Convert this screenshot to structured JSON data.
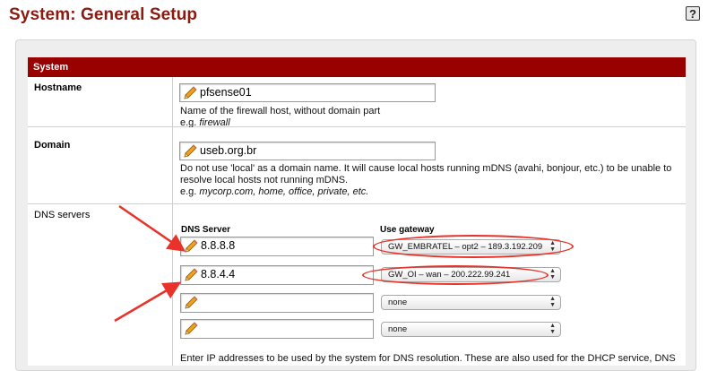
{
  "page": {
    "title": "System: General Setup",
    "help_icon": "help-icon"
  },
  "section": {
    "title": "System"
  },
  "hostname": {
    "label": "Hostname",
    "value": "pfsense01",
    "help_line1": "Name of the firewall host, without domain part",
    "help_eg": "e.g. ",
    "help_example": "firewall"
  },
  "domain": {
    "label": "Domain",
    "value": "useb.org.br",
    "help_line1": "Do not use 'local' as a domain name. It will cause local hosts running mDNS (avahi, bonjour, etc.) to be unable to",
    "help_line2": "resolve local hosts not running mDNS.",
    "help_eg": "e.g. ",
    "help_example": "mycorp.com, home, office, private, etc."
  },
  "dns": {
    "label": "DNS servers",
    "col_server": "DNS Server",
    "col_gateway": "Use gateway",
    "rows": [
      {
        "server": "8.8.8.8",
        "gateway": "GW_EMBRATEL – opt2 – 189.3.192.209"
      },
      {
        "server": "8.8.4.4",
        "gateway": "GW_OI – wan – 200.222.99.241"
      },
      {
        "server": "",
        "gateway": "none"
      },
      {
        "server": "",
        "gateway": "none"
      }
    ],
    "help_partial": "Enter IP addresses to be used by the system for DNS resolution. These are also used for the DHCP service, DNS"
  },
  "colors": {
    "title": "#8b1a10",
    "section_header_bg": "#990000",
    "annotation": "#e8322a",
    "panel_bg": "#eeeeee"
  },
  "icons": {
    "input_prefix": "pencil-icon",
    "select_arrows": "updown-arrows-icon"
  }
}
